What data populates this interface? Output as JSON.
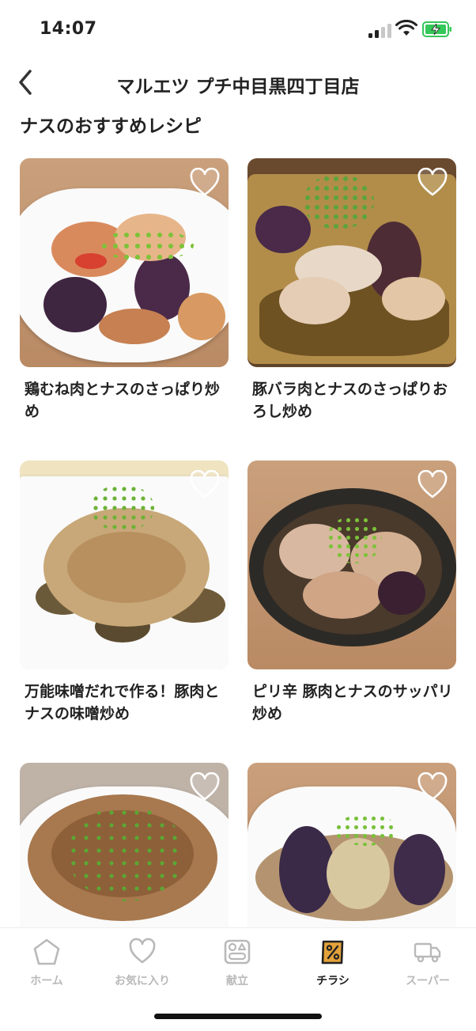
{
  "status_bar": {
    "time": "14:07"
  },
  "header": {
    "title": "マルエツ プチ中目黒四丁目店"
  },
  "section": {
    "title": "ナスのおすすめレシピ"
  },
  "recipes": [
    {
      "title": "鶏むね肉とナスのさっぱり炒め"
    },
    {
      "title": "豚バラ肉とナスのさっぱりおろし炒め"
    },
    {
      "title": "万能味噌だれで作る！豚肉とナスの味噌炒め"
    },
    {
      "title": "ピリ辛 豚肉とナスのサッパリ炒め"
    },
    {
      "title": ""
    },
    {
      "title": ""
    }
  ],
  "tabbar": {
    "tabs": [
      {
        "label": "ホーム",
        "icon": "home-icon"
      },
      {
        "label": "お気に入り",
        "icon": "heart-icon"
      },
      {
        "label": "献立",
        "icon": "menu-plan-icon"
      },
      {
        "label": "チラシ",
        "icon": "flyer-icon"
      },
      {
        "label": "スーパー",
        "icon": "truck-icon"
      }
    ],
    "active": "チラシ"
  },
  "colors": {
    "accent": "#e3a23a",
    "inactive": "#b9b9b9",
    "text": "#222222"
  }
}
